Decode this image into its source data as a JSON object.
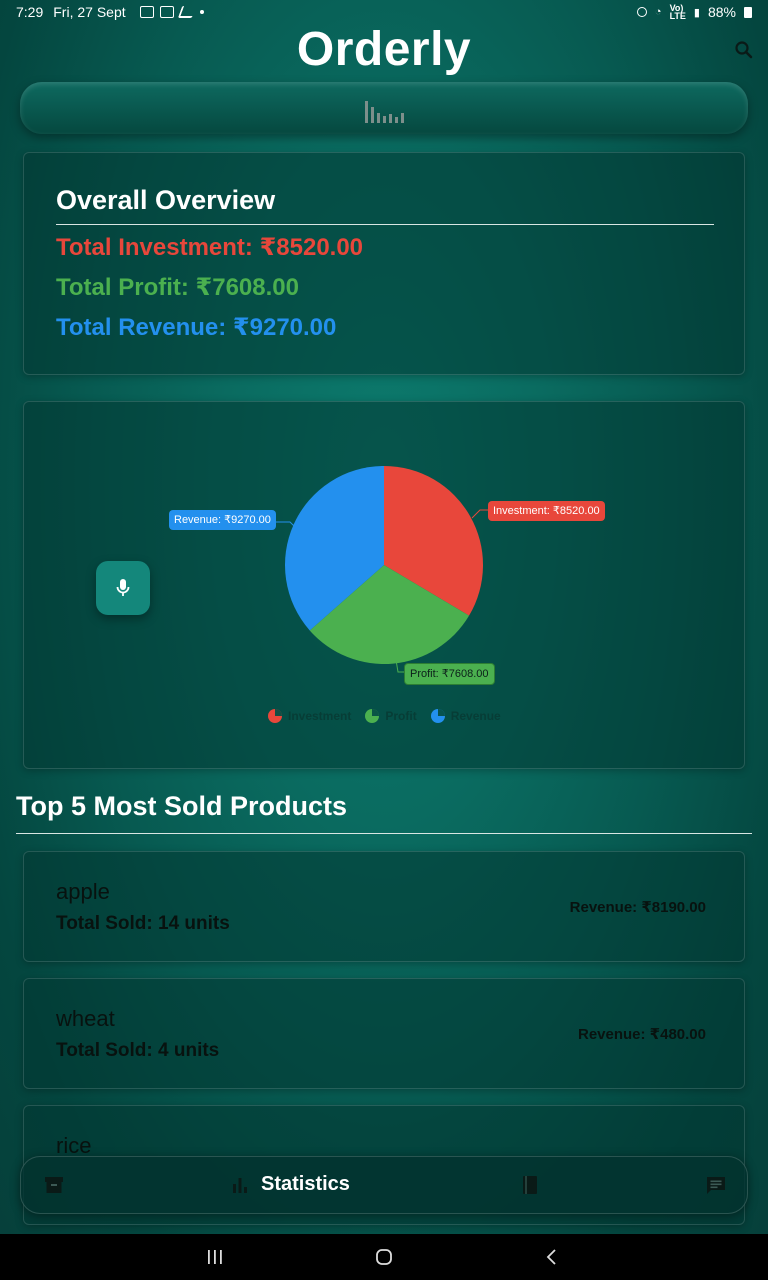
{
  "status_bar": {
    "time": "7:29",
    "date": "Fri, 27 Sept",
    "battery": "88%"
  },
  "header": {
    "title": "Orderly",
    "search_icon": "search-icon"
  },
  "overview": {
    "title": "Overall Overview",
    "investment": "Total Investment: ₹8520.00",
    "profit": "Total Profit: ₹7608.00",
    "revenue": "Total Revenue: ₹9270.00"
  },
  "chart_data": {
    "type": "pie",
    "categories": [
      "Investment",
      "Profit",
      "Revenue"
    ],
    "values": [
      8520.0,
      7608.0,
      9270.0
    ],
    "colors": [
      "#e8473b",
      "#4bb04f",
      "#2390ee"
    ],
    "labels": [
      "Investment: ₹8520.00",
      "Profit: ₹7608.00",
      "Revenue: ₹9270.00"
    ],
    "legend": [
      "Investment",
      "Profit",
      "Revenue"
    ],
    "legend_position": "bottom"
  },
  "products": {
    "title": "Top 5 Most Sold Products",
    "items": [
      {
        "name": "apple",
        "sold": "Total Sold: 14 units",
        "revenue": "Revenue: ₹8190.00"
      },
      {
        "name": "wheat",
        "sold": "Total Sold: 4 units",
        "revenue": "Revenue: ₹480.00"
      },
      {
        "name": "rice"
      }
    ]
  },
  "bottom_nav": {
    "active_label": "Statistics",
    "icons": [
      "archive-icon",
      "bar-chart-icon",
      "book-icon",
      "chat-icon"
    ]
  },
  "mic_icon": "mic-icon"
}
